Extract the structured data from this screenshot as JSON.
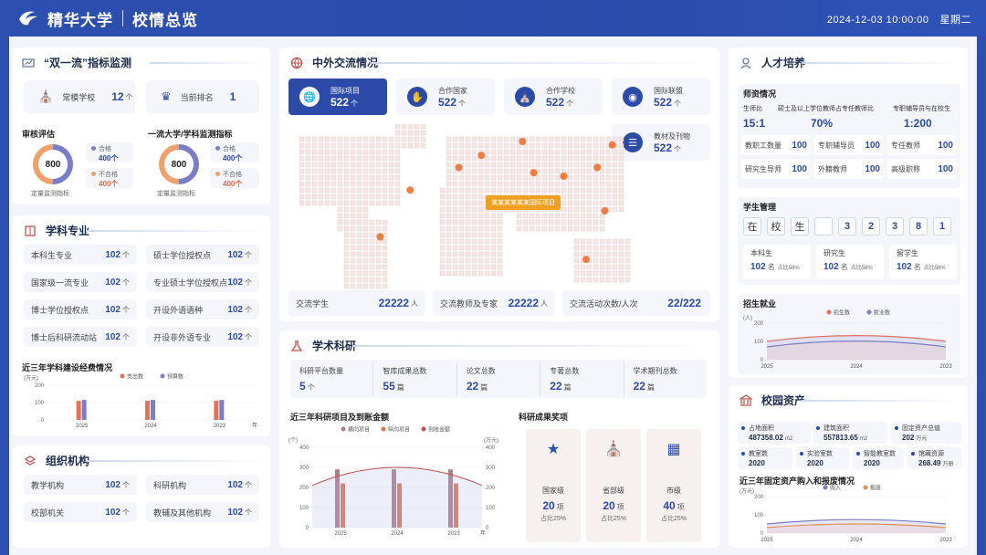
{
  "header": {
    "school": "精华大学",
    "title": "校情总览",
    "datetime": "2024-12-03 10:00:00",
    "weekday": "星期二"
  },
  "shuangyiliu": {
    "title": "“双一流”指标监测",
    "cards": [
      {
        "label": "常模学校",
        "value": "12",
        "unit": "个"
      },
      {
        "label": "当前排名",
        "value": "1",
        "unit": ""
      }
    ],
    "audit": {
      "title": "审核评估",
      "center": "800",
      "caption": "定量监测指标",
      "pass_label": "合格",
      "pass_value": "400",
      "pass_unit": "个",
      "fail_label": "不合格",
      "fail_value": "400",
      "fail_unit": "个"
    },
    "monitor": {
      "title": "一流大学/学科监测指标",
      "center": "800",
      "caption": "定量监测指标",
      "pass_label": "合格",
      "pass_value": "400",
      "pass_unit": "个",
      "fail_label": "不合格",
      "fail_value": "400",
      "fail_unit": "个"
    }
  },
  "xueke": {
    "title": "学科专业",
    "items": [
      {
        "label": "本科生专业",
        "value": "102",
        "unit": "个"
      },
      {
        "label": "硕士学位授权点",
        "value": "102",
        "unit": "个"
      },
      {
        "label": "国家级一流专业",
        "value": "102",
        "unit": "个"
      },
      {
        "label": "专业硕士学位授权点",
        "value": "102",
        "unit": "个"
      },
      {
        "label": "博士学位授权点",
        "value": "102",
        "unit": "个"
      },
      {
        "label": "开设外语语种",
        "value": "102",
        "unit": "个"
      },
      {
        "label": "博士后科研流动站",
        "value": "102",
        "unit": "个"
      },
      {
        "label": "开设非外语专业",
        "value": "102",
        "unit": "个"
      }
    ],
    "chart_title": "近三年学科建设经费情况",
    "chart_unit": "(万元)",
    "legend": [
      "支出数",
      "预算数"
    ]
  },
  "zuzhi": {
    "title": "组织机构",
    "items": [
      {
        "label": "教学机构",
        "value": "102",
        "unit": "个"
      },
      {
        "label": "科研机构",
        "value": "102",
        "unit": "个"
      },
      {
        "label": "校部机关",
        "value": "102",
        "unit": "个"
      },
      {
        "label": "教辅及其他机构",
        "value": "102",
        "unit": "个"
      }
    ]
  },
  "exchange": {
    "title": "中外交流情况",
    "cards": [
      {
        "label": "国际项目",
        "value": "522",
        "unit": "个",
        "icon": "globe-icon"
      },
      {
        "label": "合作国家",
        "value": "522",
        "unit": "个",
        "icon": "handshake-icon"
      },
      {
        "label": "合作学校",
        "value": "522",
        "unit": "个",
        "icon": "school-icon"
      },
      {
        "label": "国际联盟",
        "value": "522",
        "unit": "个",
        "icon": "world-icon"
      },
      {
        "label": "教材及刊物",
        "value": "522",
        "unit": "个",
        "icon": "books-icon"
      }
    ],
    "map_tooltip": "某某某某某某国际项目",
    "stats": [
      {
        "label": "交流学生",
        "value": "22222",
        "unit": "人"
      },
      {
        "label": "交流教师及专家",
        "value": "22222",
        "unit": "人"
      },
      {
        "label": "交流活动次数/人次",
        "value": "22/222",
        "unit": ""
      }
    ]
  },
  "keyan": {
    "title": "学术科研",
    "stats": [
      {
        "label": "科研平台数量",
        "value": "5",
        "unit": "个"
      },
      {
        "label": "智库成果总数",
        "value": "55",
        "unit": "篇"
      },
      {
        "label": "论文总数",
        "value": "22",
        "unit": "篇"
      },
      {
        "label": "专著总数",
        "value": "22",
        "unit": "篇"
      },
      {
        "label": "学术期刊总数",
        "value": "22",
        "unit": "篇"
      }
    ],
    "chart_title": "近三年科研项目及到账金额",
    "unit_left": "(个)",
    "unit_right": "(万元)",
    "legend": [
      "横向项目",
      "纵向项目",
      "到账金额"
    ],
    "year_suffix": "年",
    "awards_title": "科研成果奖项",
    "awards": [
      {
        "label": "国家级",
        "value": "20",
        "unit": "项",
        "pct": "占比25%"
      },
      {
        "label": "省部级",
        "value": "20",
        "unit": "项",
        "pct": "占比25%"
      },
      {
        "label": "市级",
        "value": "40",
        "unit": "项",
        "pct": "占比25%"
      }
    ]
  },
  "rencai": {
    "title": "人才培养",
    "shizi_title": "师资情况",
    "ratios": [
      {
        "label": "生师比",
        "value": "15:1"
      },
      {
        "label": "硕士及以上学位教师占专任教师比",
        "value": "70%"
      },
      {
        "label": "专职辅导员与在校生",
        "value": "1:200"
      }
    ],
    "counts": [
      {
        "label": "教职工数量",
        "value": "100"
      },
      {
        "label": "专职辅导员",
        "value": "100"
      },
      {
        "label": "专任教师",
        "value": "100"
      },
      {
        "label": "研究生导师",
        "value": "100"
      },
      {
        "label": "外籍教师",
        "value": "100"
      },
      {
        "label": "高级职称",
        "value": "100"
      }
    ],
    "xuesheng_title": "学生管理",
    "board": [
      "在",
      "校",
      "生",
      "",
      "3",
      "2",
      "3",
      "8",
      "1"
    ],
    "students": [
      {
        "label": "本科生",
        "value": "102",
        "unit": "名",
        "pct": "占比58%"
      },
      {
        "label": "研究生",
        "value": "102",
        "unit": "名",
        "pct": "占比58%"
      },
      {
        "label": "留学生",
        "value": "102",
        "unit": "名",
        "pct": "占比58%"
      }
    ],
    "zhaosheng_title": "招生就业",
    "zs_unit": "(人)",
    "zs_legend": [
      "招生数",
      "就业数"
    ]
  },
  "zichan": {
    "title": "校园资产",
    "items": [
      {
        "label": "占地面积",
        "value": "487358.02",
        "unit": "m2"
      },
      {
        "label": "建筑面积",
        "value": "557813.65",
        "unit": "m2"
      },
      {
        "label": "固定资产总值",
        "value": "202",
        "unit": "万元"
      },
      {
        "label": "教室数",
        "value": "2020",
        "unit": ""
      },
      {
        "label": "实验室数",
        "value": "2020",
        "unit": ""
      },
      {
        "label": "智能教室数",
        "value": "2020",
        "unit": ""
      },
      {
        "label": "馆藏资源",
        "value": "268.49",
        "unit": "万册"
      }
    ],
    "chart_title": "近三年固定资产购入和报废情况",
    "chart_unit": "(万元)",
    "legend": [
      "购入",
      "报废"
    ]
  },
  "chart_data": [
    {
      "type": "bar",
      "title": "近三年学科建设经费情况",
      "ylabel": "(万元)",
      "categories": [
        "2025",
        "2024",
        "2023"
      ],
      "x_suffix": "年",
      "yticks": [
        0,
        100,
        200
      ],
      "ylim": [
        0,
        200
      ],
      "series": [
        {
          "name": "支出数",
          "values": [
            110,
            110,
            110
          ]
        },
        {
          "name": "预算数",
          "values": [
            115,
            115,
            115
          ]
        }
      ],
      "colors": [
        "#e0735a",
        "#7a7ec7"
      ]
    },
    {
      "type": "bar",
      "title": "近三年科研项目及到账金额",
      "ylabel": "(个)",
      "y2label": "(万元)",
      "categories": [
        "2025",
        "2024",
        "2023"
      ],
      "x_suffix": "年",
      "yticks": [
        0,
        100,
        200,
        300,
        400
      ],
      "ylim": [
        0,
        400
      ],
      "y2ticks": [
        0,
        100,
        200,
        300,
        400
      ],
      "series": [
        {
          "name": "横向项目",
          "values": [
            290,
            290,
            290
          ]
        },
        {
          "name": "纵向项目",
          "values": [
            220,
            220,
            220
          ]
        },
        {
          "name": "到账金额",
          "type": "line",
          "values": [
            210,
            300,
            210
          ]
        }
      ],
      "colors": [
        "#b37a8a",
        "#e07050",
        "#c05050"
      ]
    },
    {
      "type": "line",
      "title": "招生就业",
      "ylabel": "(人)",
      "categories": [
        "2025",
        "2024",
        "2023"
      ],
      "yticks": [
        0,
        100,
        200
      ],
      "ylim": [
        0,
        200
      ],
      "series": [
        {
          "name": "招生数",
          "values": [
            100,
            140,
            100
          ]
        },
        {
          "name": "就业数",
          "values": [
            70,
            110,
            70
          ]
        }
      ],
      "colors": [
        "#e07060",
        "#7a7ec7"
      ]
    },
    {
      "type": "line",
      "title": "近三年固定资产购入和报废情况",
      "ylabel": "(万元)",
      "categories": [
        "2025",
        "2024",
        "2023"
      ],
      "yticks": [
        0,
        100,
        200
      ],
      "ylim": [
        0,
        200
      ],
      "series": [
        {
          "name": "购入",
          "values": [
            50,
            80,
            50
          ]
        },
        {
          "name": "报废",
          "values": [
            30,
            55,
            30
          ]
        }
      ],
      "colors": [
        "#7a7ec7",
        "#e0905a"
      ]
    }
  ]
}
